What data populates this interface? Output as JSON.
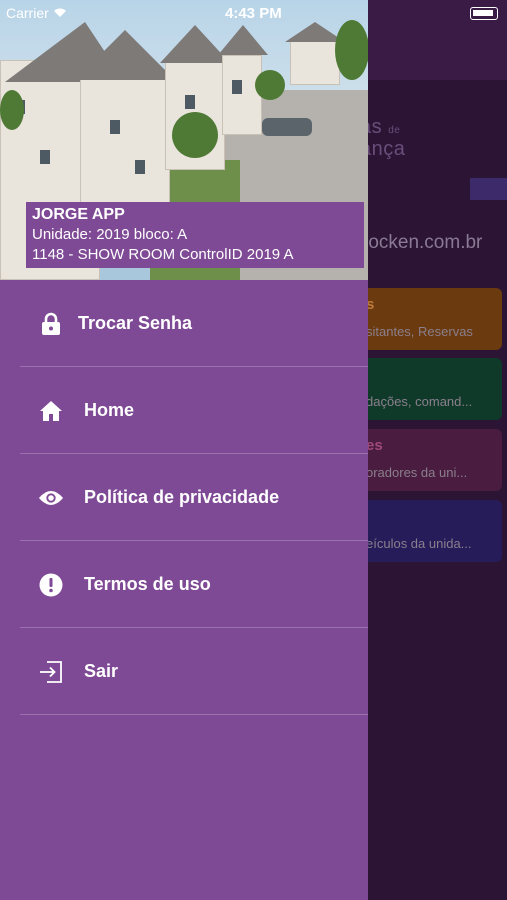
{
  "status_bar": {
    "carrier": "Carrier",
    "time": "4:43 PM"
  },
  "user": {
    "name": "JORGE APP",
    "unit": "Unidade: 2019 bloco: A",
    "condo": "1148 - SHOW ROOM ControlID 2019 A"
  },
  "menu": {
    "items": [
      {
        "label": "Trocar Senha",
        "icon": "lock-icon"
      },
      {
        "label": "Home",
        "icon": "home-icon"
      },
      {
        "label": "Política de privacidade",
        "icon": "eye-icon"
      },
      {
        "label": "Termos de uso",
        "icon": "alert-icon"
      },
      {
        "label": "Sair",
        "icon": "logout-icon"
      }
    ]
  },
  "background": {
    "logo_line1": "as",
    "logo_line2": "ança",
    "logo_small": "de",
    "site": "rocken.com.br",
    "cards": [
      {
        "title": "s",
        "subtitle": "sitantes, Reservas"
      },
      {
        "title": "",
        "subtitle": "dações, comand..."
      },
      {
        "title": "es",
        "subtitle": "oradores da uni..."
      },
      {
        "title": "",
        "subtitle": "eículos da unida..."
      }
    ]
  },
  "colors": {
    "drawer": "#7f4a95",
    "overlay_bg": "#2b1434",
    "text": "#ffffff"
  }
}
